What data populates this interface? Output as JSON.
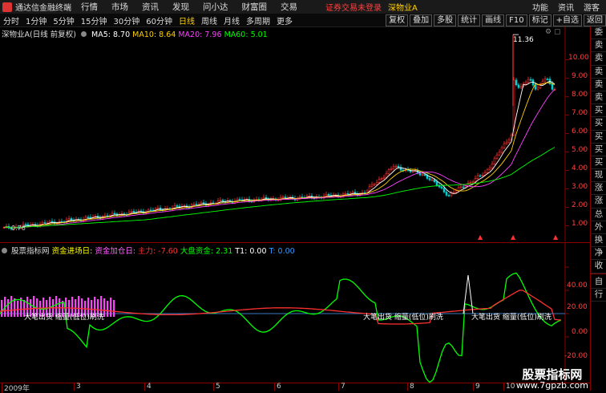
{
  "menubar": {
    "app_title": "通达信金融终端",
    "items": [
      "行情",
      "市场",
      "资讯",
      "发现",
      "问小达",
      "财富圈",
      "交易"
    ],
    "notice": "证券交易未登录",
    "stock": "深物业A",
    "right": [
      "功能",
      "资讯",
      "游客"
    ]
  },
  "toolbar": {
    "periods": [
      "分时",
      "1分钟",
      "5分钟",
      "15分钟",
      "30分钟",
      "60分钟",
      "日线",
      "周线",
      "月线",
      "多周期",
      "更多"
    ],
    "active_period": "日线",
    "buttons": [
      "复权",
      "叠加",
      "多股",
      "统计",
      "画线",
      "F10",
      "标记",
      "+自选",
      "返回"
    ]
  },
  "main_legend": {
    "stock_label": "深物业A(日线 前复权)",
    "ma5": "MA5: 8.70",
    "ma10": "MA10: 8.64",
    "ma20": "MA20: 7.96",
    "ma60": "MA60: 5.01"
  },
  "price_axis": [
    "10.00",
    "9.00",
    "8.00",
    "7.00",
    "6.00",
    "5.00",
    "4.00",
    "3.00",
    "2.00",
    "1.00"
  ],
  "high_label": "11.36",
  "low_label": "0.76",
  "indicator_legend": {
    "name": "股票指标网",
    "items": [
      {
        "label": "资金进场日:",
        "color": "#ffff00"
      },
      {
        "label": "资金加仓日:",
        "color": "#ff60ff"
      },
      {
        "label": "主力: -7.60",
        "color": "#ff3030"
      },
      {
        "label": "大盘资金: 2.31",
        "color": "#00ff00"
      },
      {
        "label": "T1: 0.00",
        "color": "#ffffff"
      },
      {
        "label": "T: 0.00",
        "color": "#3399ff"
      }
    ]
  },
  "indicator_axis": [
    "40.00",
    "20.00",
    "0.00",
    "-20.00"
  ],
  "annotations": [
    "大笔出货 缩量(低位)刷洗",
    "大笔出货 缩量(低位)刷洗",
    "大笔出货 缩量(低位)刷洗"
  ],
  "sidebar": {
    "top": [
      "委比",
      "卖五",
      "卖四",
      "卖三",
      "卖二",
      "卖一",
      "买一",
      "买二",
      "买三",
      "买四",
      "买五",
      "现价",
      "涨跌",
      "涨幅",
      "总量",
      "外盘",
      "换手",
      "净资",
      "收益"
    ],
    "bottom": [
      "自动",
      "行情"
    ]
  },
  "time_axis": [
    "2009年",
    "3",
    "4",
    "5",
    "6",
    "7",
    "8",
    "9",
    "10"
  ],
  "watermark": {
    "line1": "股票指标网",
    "line2": "www.7gpzb.com"
  },
  "colors": {
    "ma5": "#ffffff",
    "ma10": "#ffd000",
    "ma20": "#ff40ff",
    "ma60": "#00ff00",
    "up": "#ff3030",
    "down": "#00d0d0",
    "accent": "#ffd000"
  }
}
